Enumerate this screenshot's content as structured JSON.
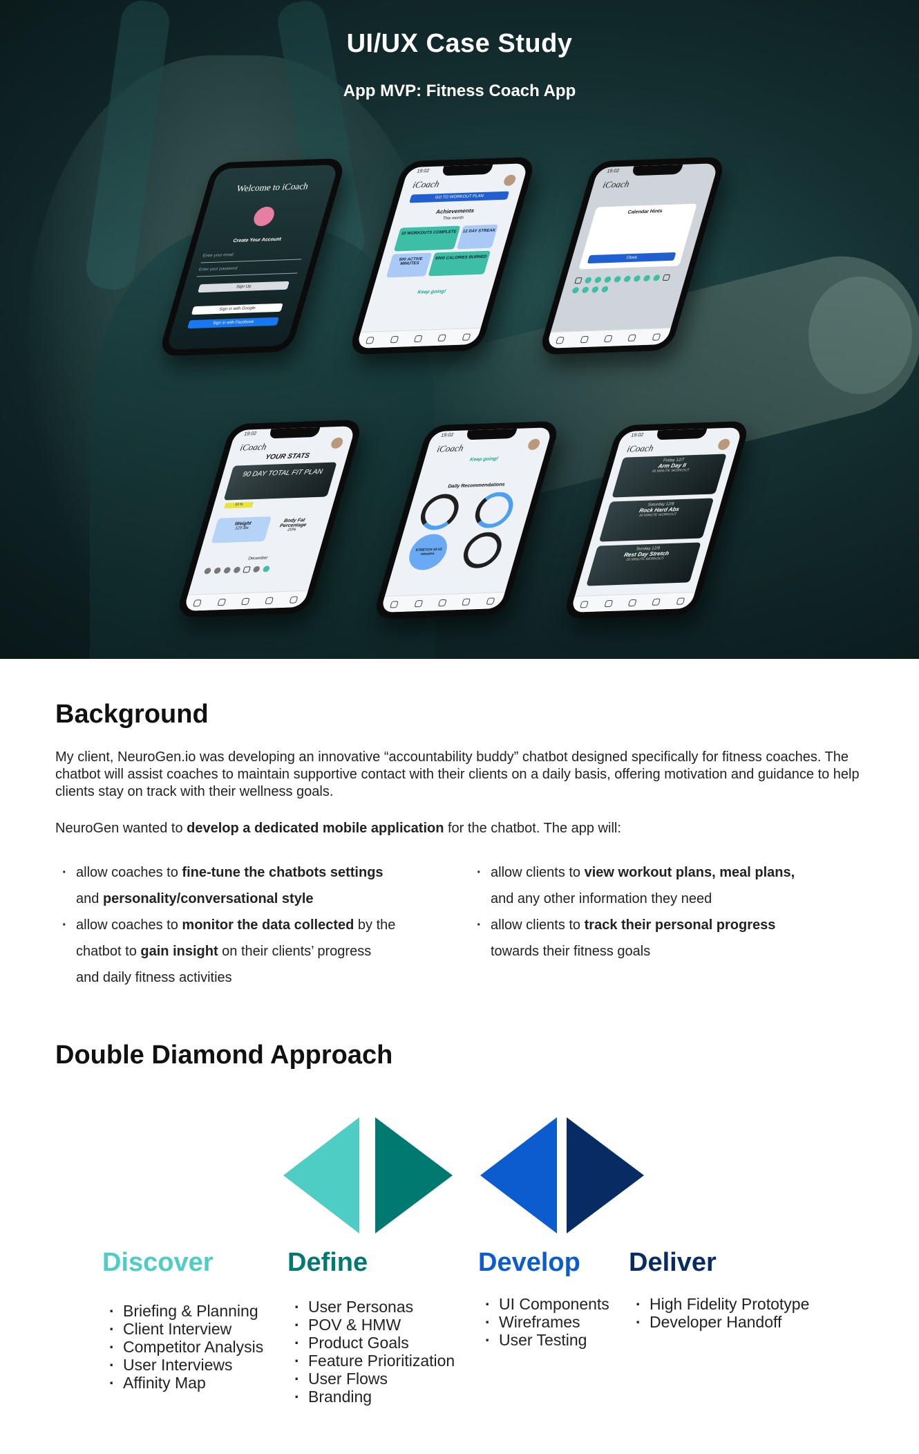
{
  "hero": {
    "title": "UI/UX Case Study",
    "subtitle": "App MVP: Fitness Coach App"
  },
  "phones": {
    "welcome": {
      "title": "Welcome to iCoach",
      "create_account": "Create Your Account",
      "email_placeholder": "Enter your email",
      "password_placeholder": "Enter your password",
      "sign_up": "Sign Up",
      "google": "Sign in with Google",
      "facebook": "Sign in with Facebook"
    },
    "home": {
      "time": "19:02",
      "logo": "iCoach",
      "cta": "GO TO WORKOUT PLAN",
      "achievements": "Achievements",
      "period": "This month",
      "tile_workouts": "10 WORKOUTS COMPLETE",
      "tile_streak": "12 DAY STREAK",
      "tile_minutes": "500 ACTIVE MINUTES",
      "tile_calories": "6000 CALORIES BURNED",
      "keep_going": "Keep going!"
    },
    "calendar": {
      "time": "19:02",
      "logo": "iCoach",
      "hints_title": "Calendar Hints",
      "close": "Close"
    },
    "stats": {
      "time": "19:02",
      "logo": "iCoach",
      "heading": "YOUR STATS",
      "plan": "90 DAY TOTAL FIT PLAN",
      "progress": "33 %",
      "weight_label": "Weight",
      "weight_value": "125 lbs",
      "fat_label": "Body Fat Percentage",
      "fat_value": "20%",
      "month": "December"
    },
    "recommend": {
      "time": "19:02",
      "logo": "iCoach",
      "keep_going": "Keep going!",
      "heading": "Daily Recommendations",
      "burn": "BURN 500 calories",
      "walk": "WALK 6-7k steps",
      "stretch": "STRETCH 10-15 minutes",
      "complete": "COMPLETE Daily Workout"
    },
    "plan": {
      "time": "19:02",
      "logo": "iCoach",
      "w1_day": "Friday 12/7",
      "w1_name": "Arm Day II",
      "w1_len": "45 MINUTE WORKOUT",
      "w2_day": "Saturday 12/8",
      "w2_name": "Rock Hard Abs",
      "w2_len": "30 MINUTE WORKOUT",
      "w3_day": "Sunday 12/9",
      "w3_name": "Rest Day Stretch",
      "w3_len": "20 MINUTE WORKOUT"
    }
  },
  "background": {
    "heading": "Background",
    "p1": "My client, NeuroGen.io was developing an innovative “accountability buddy” chatbot designed specifically for fitness coaches. The chatbot will assist coaches to maintain supportive contact with their clients on a daily basis, offering motivation and guidance to help clients stay on track with their wellness goals.",
    "p2_pre": "NeuroGen wanted to ",
    "p2_bold": "develop a dedicated mobile application",
    "p2_post": " for the chatbot. The app will:",
    "left": [
      {
        "a": "allow coaches to ",
        "b": "fine-tune the chatbots settings",
        "c": ""
      },
      {
        "a": "and ",
        "b": "personality/conversational style",
        "c": ""
      },
      {
        "a": "allow coaches to ",
        "b": "monitor the data collected",
        "c": " by the"
      },
      {
        "a": "chatbot to ",
        "b": "gain insight",
        "c": " on their clients’ progress"
      },
      {
        "a": "and daily fitness activities",
        "b": "",
        "c": ""
      }
    ],
    "right": [
      {
        "a": "allow clients to ",
        "b": "view workout plans, meal plans,",
        "c": ""
      },
      {
        "a": "and any other information they need",
        "b": "",
        "c": ""
      },
      {
        "a": "allow clients to ",
        "b": "track their personal progress",
        "c": ""
      },
      {
        "a": "towards their fitness goals",
        "b": "",
        "c": ""
      }
    ]
  },
  "double_diamond": {
    "heading": "Double Diamond Approach",
    "colors": {
      "discover": "#4ecdc4",
      "define": "#007a70",
      "develop": "#0a5ccf",
      "deliver": "#062c63"
    },
    "phases": [
      {
        "title": "Discover",
        "items": [
          "Briefing & Planning",
          "Client Interview",
          "Competitor Analysis",
          "User Interviews",
          "Affinity Map"
        ]
      },
      {
        "title": "Define",
        "items": [
          "User Personas",
          "POV & HMW",
          "Product Goals",
          "Feature Prioritization",
          "User Flows",
          "Branding"
        ]
      },
      {
        "title": "Develop",
        "items": [
          "UI Components",
          "Wireframes",
          "User Testing"
        ]
      },
      {
        "title": "Deliver",
        "items": [
          "High Fidelity Prototype",
          "Developer Handoff"
        ]
      }
    ]
  }
}
